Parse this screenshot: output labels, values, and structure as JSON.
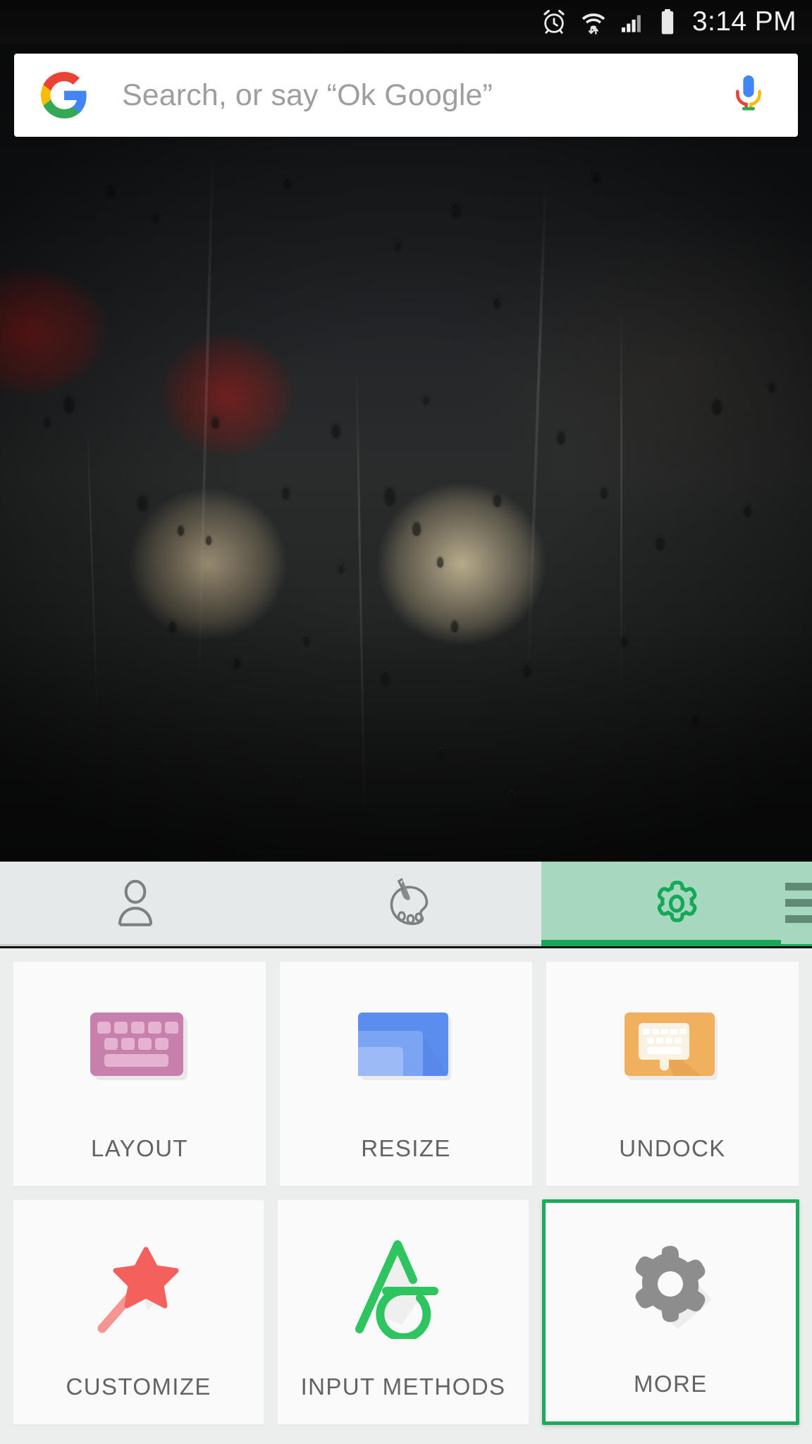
{
  "statusbar": {
    "time": "3:14 PM",
    "icons": [
      {
        "name": "alarm-icon",
        "label": "alarm"
      },
      {
        "name": "wifi-icon",
        "label": "wifi with data transfer"
      },
      {
        "name": "cellular-signal-icon",
        "label": "signal"
      },
      {
        "name": "battery-icon",
        "label": "battery"
      }
    ]
  },
  "search": {
    "placeholder": "Search, or say “Ok Google”",
    "logo_icon": "google-g-icon",
    "mic_icon": "google-mic-icon"
  },
  "tabs": [
    {
      "id": "account",
      "icon": "person-icon",
      "active": false
    },
    {
      "id": "theme",
      "icon": "palette-icon",
      "active": false
    },
    {
      "id": "settings",
      "icon": "gear-outline-icon",
      "active": true
    }
  ],
  "overflow": {
    "icon": "hamburger-menu-icon"
  },
  "grid": {
    "rows": [
      [
        {
          "label": "LAYOUT",
          "icon": "keyboard-layout-icon",
          "selected": false
        },
        {
          "label": "RESIZE",
          "icon": "resize-windows-icon",
          "selected": false
        },
        {
          "label": "UNDOCK",
          "icon": "undock-keyboard-icon",
          "selected": false
        }
      ],
      [
        {
          "label": "CUSTOMIZE",
          "icon": "magic-wand-icon",
          "selected": false
        },
        {
          "label": "INPUT METHODS",
          "icon": "input-methods-icon",
          "selected": false
        },
        {
          "label": "MORE",
          "icon": "gear-solid-icon",
          "selected": true
        }
      ]
    ]
  },
  "colors": {
    "accent_green": "#1cab5c",
    "tab_active_bg": "#a5d8bd",
    "panel_bg": "#eceded",
    "card_bg": "#fafafa",
    "layout_pink": "#c77fab",
    "resize_blue": "#5b8def",
    "undock_orange": "#f0b05e",
    "customize_red": "#f4605c",
    "more_gray": "#8d8d8d"
  }
}
